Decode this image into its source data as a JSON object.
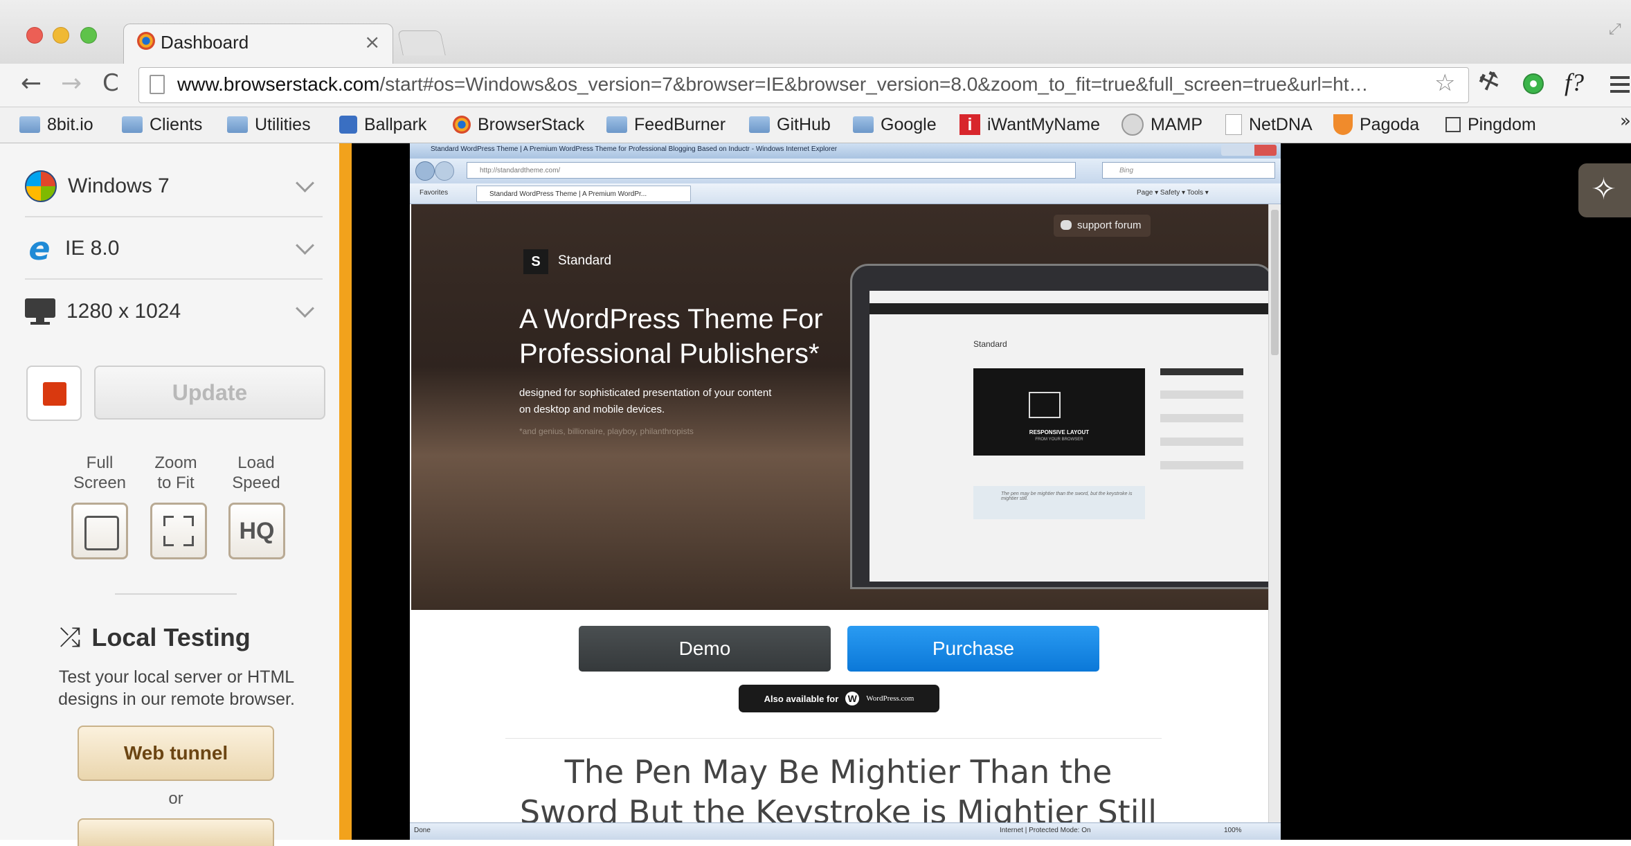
{
  "window": {
    "tab_title": "Dashboard",
    "tab_close": "×",
    "url_domain": "www.browserstack.com",
    "url_path": "/start#os=Windows&os_version=7&browser=IE&browser_version=8.0&zoom_to_fit=true&full_screen=true&url=ht…",
    "toolbar_icons": [
      "back-arrow-icon",
      "forward-arrow-icon",
      "reload-icon",
      "star-icon",
      "wrench-icon",
      "ghostery-icon",
      "font-finder-icon",
      "menu-icon"
    ],
    "fontfinder_label": "f?"
  },
  "bookmarks": [
    {
      "label": "8bit.io",
      "icon": "folder-icon"
    },
    {
      "label": "Clients",
      "icon": "folder-icon"
    },
    {
      "label": "Utilities",
      "icon": "folder-icon"
    },
    {
      "label": "Ballpark",
      "icon": "ballpark-icon"
    },
    {
      "label": "BrowserStack",
      "icon": "browserstack-icon"
    },
    {
      "label": "FeedBurner",
      "icon": "folder-icon"
    },
    {
      "label": "GitHub",
      "icon": "folder-icon"
    },
    {
      "label": "Google",
      "icon": "folder-icon"
    },
    {
      "label": "iWantMyName",
      "icon": "iwantmyname-icon"
    },
    {
      "label": "MAMP",
      "icon": "mamp-icon"
    },
    {
      "label": "NetDNA",
      "icon": "page-icon"
    },
    {
      "label": "Pagoda",
      "icon": "pagoda-icon"
    },
    {
      "label": "Pingdom",
      "icon": "pingdom-icon"
    }
  ],
  "bookmarks_overflow": "»",
  "sidebar": {
    "os_label": "Windows 7",
    "browser_label": "IE 8.0",
    "resolution_label": "1280 x 1024",
    "update_label": "Update",
    "options": [
      {
        "label_line1": "Full",
        "label_line2": "Screen",
        "icon": "full-screen-icon"
      },
      {
        "label_line1": "Zoom",
        "label_line2": "to Fit",
        "icon": "zoom-to-fit-icon"
      },
      {
        "label_line1": "Load",
        "label_line2": "Speed",
        "icon": "hq-icon",
        "box_text": "HQ"
      }
    ],
    "local_testing_title": "Local Testing",
    "local_testing_desc_line1": "Test your local server or HTML",
    "local_testing_desc_line2": "designs in our remote browser.",
    "web_tunnel_label": "Web tunnel",
    "or_label": "or"
  },
  "colors": {
    "accent_orange": "#f2a21c",
    "stop_red": "#d9390f",
    "purchase_blue": "#1486e6",
    "demo_dark": "#3f4446"
  },
  "remote": {
    "ie_title": "Standard WordPress Theme | A Premium WordPress Theme for Professional Blogging Based on Inductr - Windows Internet Explorer",
    "ie_url": "http://standardtheme.com/",
    "ie_search": "Bing",
    "ie_fav_label": "Favorites",
    "ie_tab_label": "Standard WordPress Theme | A Premium WordPr...",
    "ie_tools": "Page ▾  Safety ▾  Tools ▾",
    "ie_status_left": "Done",
    "ie_status_right": "Internet | Protected Mode: On",
    "ie_zoom": "100%",
    "support_forum": "support forum",
    "brand_letter": "S",
    "brand_name": "Standard",
    "hero_title_line1": "A WordPress Theme For",
    "hero_title_line2": "Professional Publishers*",
    "hero_sub_line1": "designed for sophisticated presentation of your content",
    "hero_sub_line2": "on desktop and mobile devices.",
    "hero_footnote": "*and genius, billionaire, playboy, philanthropists",
    "screen_heading": "Standard",
    "screen_responsive_1": "RESPONSIVE LAYOUT",
    "screen_responsive_2": "FROM YOUR BROWSER",
    "screen_quote": "The pen may be mightier than the sword, but the keystroke is mightier still.",
    "demo_label": "Demo",
    "purchase_label": "Purchase",
    "also_available": "Also available for",
    "wordpress_com": "WordPress.com",
    "heading_line1": "The Pen May Be Mightier Than the",
    "heading_line2": "Sword But the Keystroke is Mightier Still"
  }
}
